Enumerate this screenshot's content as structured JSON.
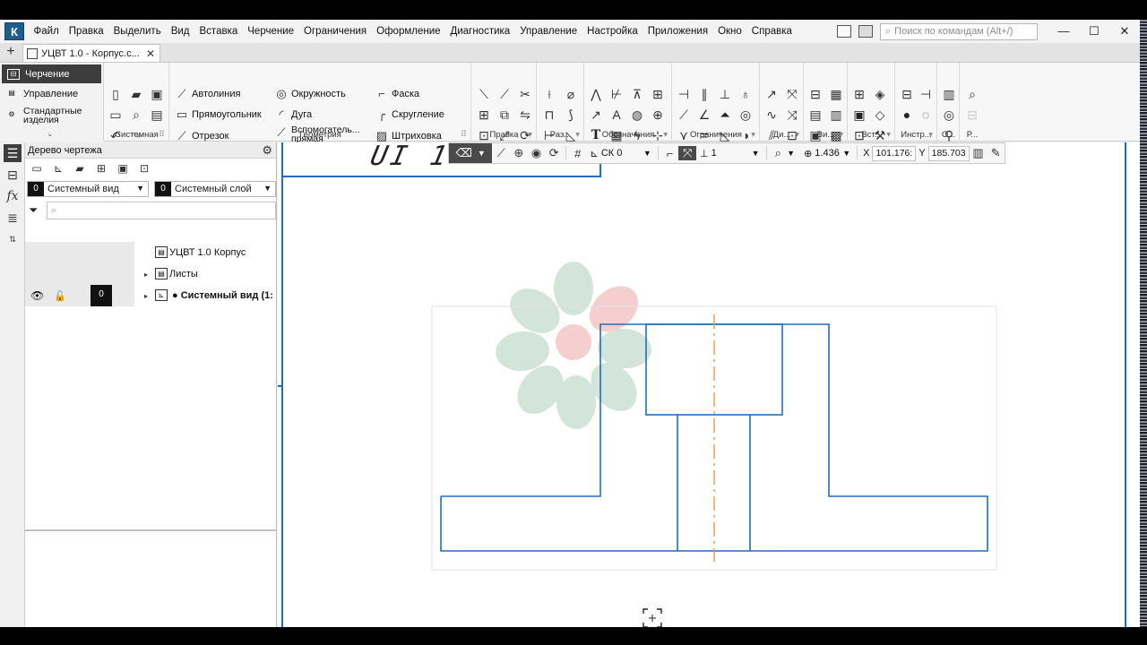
{
  "menubar": {
    "logo": "К",
    "items": [
      "Файл",
      "Правка",
      "Выделить",
      "Вид",
      "Вставка",
      "Черчение",
      "Ограничения",
      "Оформление",
      "Диагностика",
      "Управление",
      "Настройка",
      "Приложения",
      "Окно",
      "Справка"
    ],
    "search_placeholder": "Поиск по командам (Alt+/)",
    "minimize": "—",
    "maximize": "☐",
    "close": "✕"
  },
  "tabs": {
    "active": "УЦВТ 1.0 - Корпус.c...",
    "close": "✕",
    "add": "+"
  },
  "ribbon": {
    "modes": [
      "Черчение",
      "Управление",
      "Стандартные изделия"
    ],
    "groups": {
      "system": "Системная",
      "geometry": "Геометрия",
      "edit": "Правка",
      "size": "Раз...",
      "designations": "Обозначения",
      "constraints": "Ограничения",
      "di": "Ди...",
      "views": "Ви...",
      "insert": "Вст...",
      "tools": "Инстр...",
      "o": "О...",
      "r": "Р..."
    },
    "geometry_tools": {
      "autoline": "Автолиния",
      "rectangle": "Прямоугольник",
      "segment": "Отрезок",
      "circle": "Окружность",
      "arc": "Дуга",
      "aux_line": "Вспомогатель... прямая",
      "chamfer": "Фаска",
      "fillet": "Скругление",
      "hatch": "Штриховка"
    }
  },
  "tree_panel": {
    "title": "Дерево чертежа",
    "view_selector": {
      "num": "0",
      "label": "Системный вид"
    },
    "layer_selector": {
      "num": "0",
      "label": "Системный слой"
    },
    "search_placeholder": "⌕",
    "nodes": {
      "root": "УЦВТ 1.0 Корпус",
      "sheets": "Листы",
      "system_view": "● Системный вид (1:",
      "layer_num": "0"
    }
  },
  "canvas": {
    "title_text": "UI 1",
    "floating_bar": {
      "cs_label": "СК 0",
      "step": "1",
      "zoom": "1.436",
      "x_label": "X",
      "x_value": "101.176:",
      "y_label": "Y",
      "y_value": "185.703"
    }
  },
  "colors": {
    "drawing_line": "#1f6fbf",
    "axis_line": "#e0a040",
    "watermark_green": "#cfe3d6",
    "watermark_pink": "#f4c9c9"
  }
}
